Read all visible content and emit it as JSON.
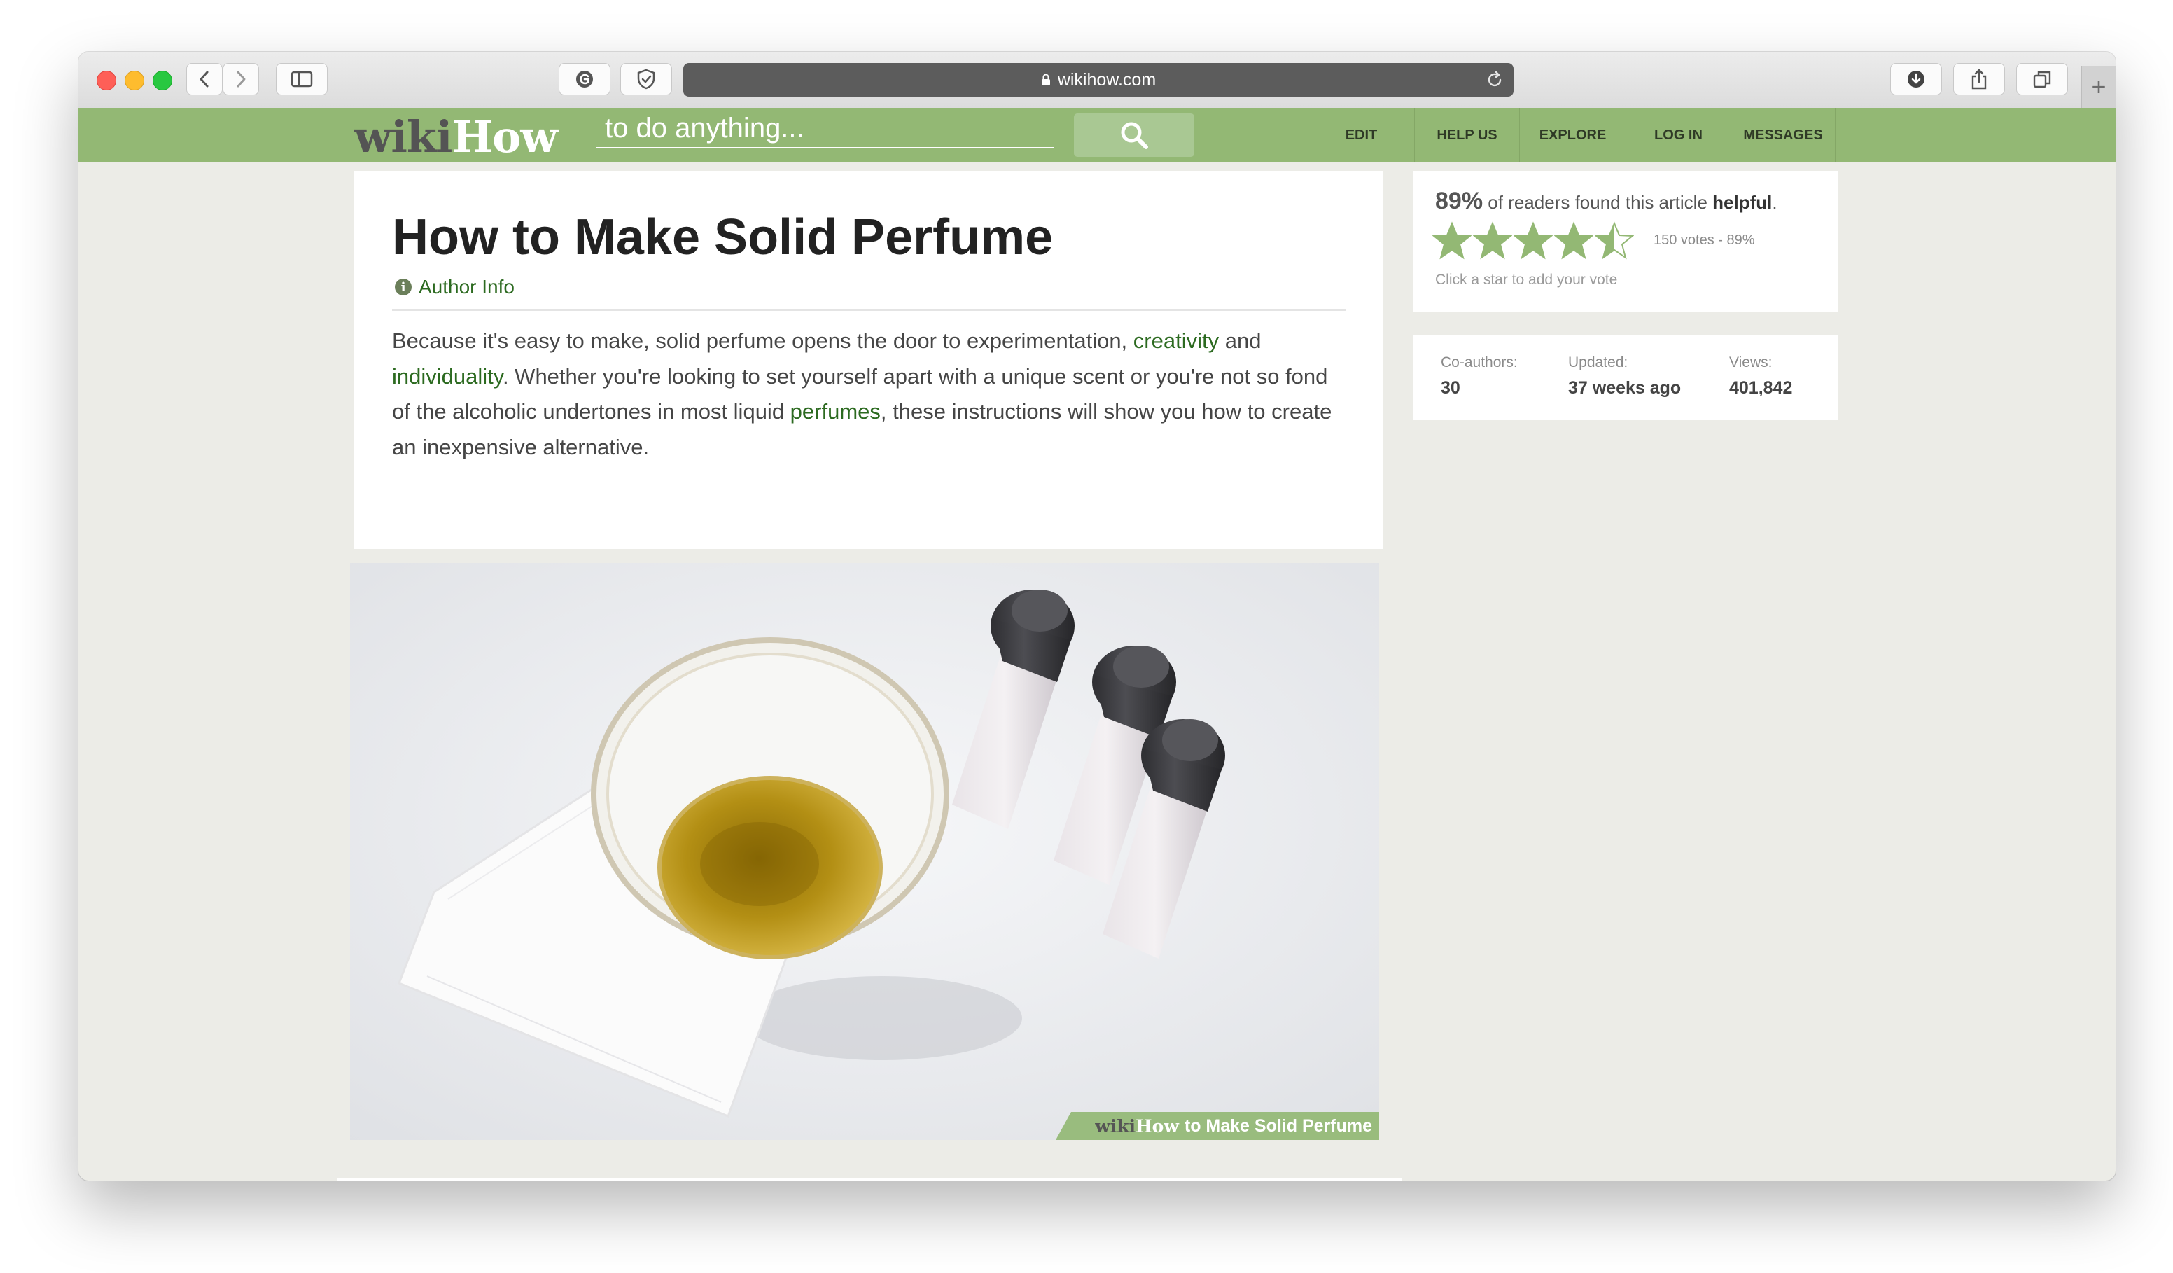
{
  "browser": {
    "url": "wikihow.com",
    "new_tab_label": "+"
  },
  "site": {
    "logo_part1": "wiki",
    "logo_part2": "How",
    "search_placeholder": "to do anything...",
    "nav": [
      "EDIT",
      "HELP US",
      "EXPLORE",
      "LOG IN",
      "MESSAGES"
    ],
    "accent_color": "#93b874",
    "link_color": "#2c6a20"
  },
  "article": {
    "title": "How to Make Solid Perfume",
    "author_info": "Author Info",
    "intro_1": "Because it's easy to make, solid perfume opens the door to experimentation, ",
    "link_creativity": "creativity",
    "intro_2": " and ",
    "link_individuality": "individuality",
    "intro_3": ". Whether you're looking to set yourself apart with a unique scent or you're not so fond of the alcoholic undertones in most liquid ",
    "link_perfumes": "perfumes",
    "intro_4": ", these instructions will show you how to create an inexpensive alternative.",
    "image_caption_wiki": "wiki",
    "image_caption_how": "How",
    "image_caption_text": "to Make Solid Perfume"
  },
  "rating": {
    "percent": "89%",
    "text_mid": " of readers found this article ",
    "text_bold": "helpful",
    "text_end": ".",
    "stars_value": 4.5,
    "stars_max": 5,
    "votes": "150 votes - 89%",
    "hint": "Click a star to add your vote"
  },
  "stats": {
    "coauthors_label": "Co-authors:",
    "coauthors_value": "30",
    "updated_label": "Updated:",
    "updated_value": "37 weeks ago",
    "views_label": "Views:",
    "views_value": "401,842"
  }
}
